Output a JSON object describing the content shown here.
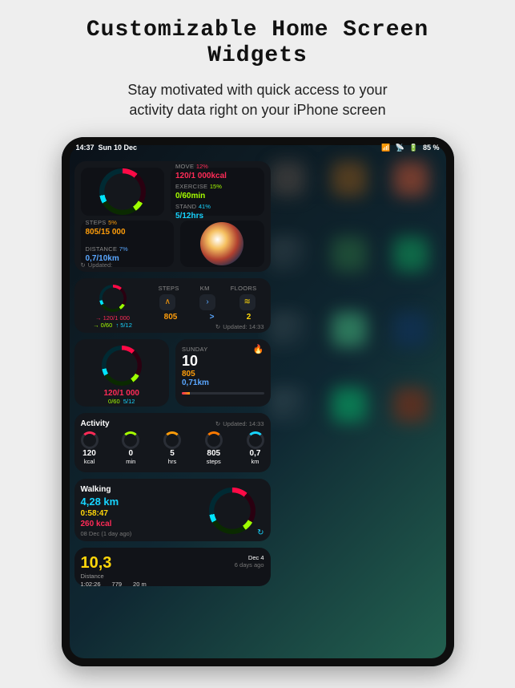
{
  "headline1": "Customizable Home Screen",
  "headline2": "Widgets",
  "subhead1": "Stay motivated with quick access to your",
  "subhead2": "activity data right on your iPhone screen",
  "status": {
    "time": "14:37",
    "date": "Sun 10 Dec",
    "battery": "85 %"
  },
  "widget1": {
    "move": {
      "lbl": "MOVE",
      "pct": "12%",
      "val": "120/1 000kcal"
    },
    "exer": {
      "lbl": "EXERCISE",
      "pct": "15%",
      "val": "0/60min"
    },
    "stand": {
      "lbl": "STAND",
      "pct": "41%",
      "val": "5/12hrs"
    },
    "steps": {
      "lbl": "STEPS",
      "pct": "5%",
      "val": "805/15 000"
    },
    "dist": {
      "lbl": "DISTANCE",
      "pct": "7%",
      "val": "0,7/10km"
    },
    "updated": "Updated:"
  },
  "widget2": {
    "move": "120/1 000",
    "exer": "0/60",
    "stand": "5/12",
    "cols": [
      "STEPS",
      "KM",
      "FLOORS"
    ],
    "vals": [
      "805",
      ">",
      "2"
    ],
    "updated": "Updated: 14:33"
  },
  "widget3": {
    "move": "120/1 000",
    "ex": "0/60",
    "st": "5/12"
  },
  "widget4": {
    "day": "SUNDAY",
    "date": "10",
    "steps": "805",
    "km": "0,71km"
  },
  "widget5": {
    "title": "Activity",
    "updated": "Updated: 14:33",
    "items": [
      {
        "v": "120",
        "u": "kcal"
      },
      {
        "v": "0",
        "u": "min"
      },
      {
        "v": "5",
        "u": "hrs"
      },
      {
        "v": "805",
        "u": "steps"
      },
      {
        "v": "0,7",
        "u": "km"
      }
    ]
  },
  "widget6": {
    "title": "Walking",
    "km": "4,28 km",
    "dur": "0:58:47",
    "kcal": "260 kcal",
    "sub": "08 Dec (1 day ago)"
  },
  "widget7": {
    "big": "10,3",
    "distLabel": "Distance",
    "t": "1:02:26",
    "s": "779",
    "m": "20 m",
    "date": "Dec 4",
    "ago": "6 days ago"
  }
}
